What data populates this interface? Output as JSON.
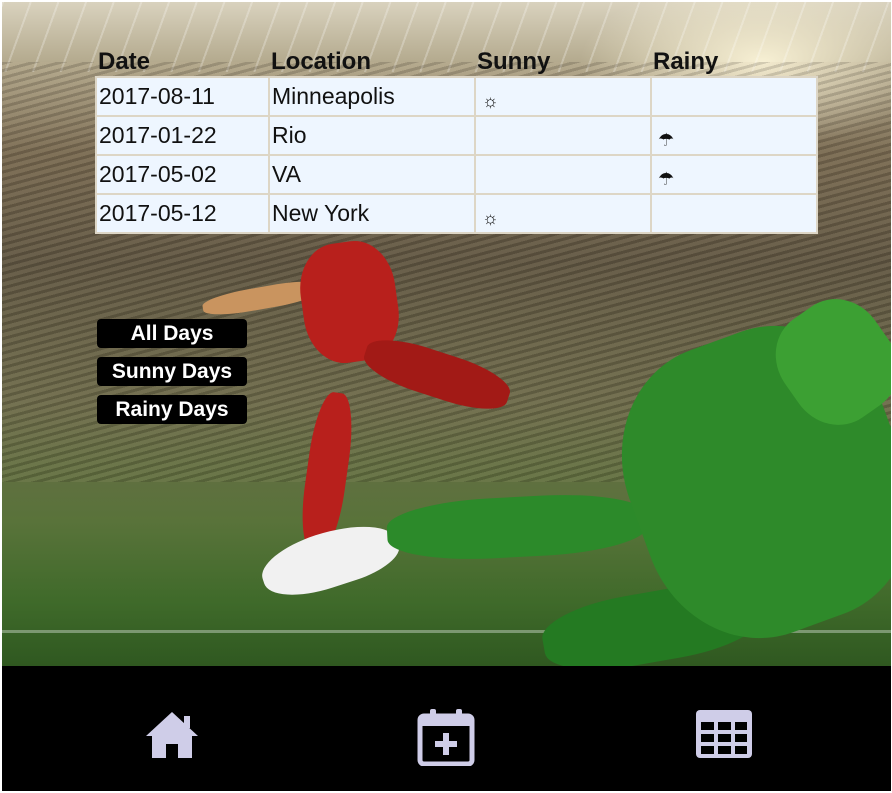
{
  "table": {
    "headers": [
      "Date",
      "Location",
      "Sunny",
      "Rainy"
    ],
    "rows": [
      {
        "date": "2017-08-11",
        "location": "Minneapolis",
        "sunny": "☼",
        "rainy": ""
      },
      {
        "date": "2017-01-22",
        "location": "Rio",
        "sunny": "",
        "rainy": "☂"
      },
      {
        "date": "2017-05-02",
        "location": "VA",
        "sunny": "",
        "rainy": "☂"
      },
      {
        "date": "2017-05-12",
        "location": "New York",
        "sunny": "☼",
        "rainy": ""
      }
    ]
  },
  "filters": {
    "all_days": "All Days",
    "sunny_days": "Sunny Days",
    "rainy_days": "Rainy Days"
  },
  "nav": {
    "icons": [
      "home-icon",
      "calendar-add-icon",
      "grid-icon"
    ],
    "icon_color": "#cfcde8"
  },
  "colors": {
    "row_bg": "#eef6ff",
    "button_bg": "#000000",
    "bar_bg": "#000000"
  }
}
